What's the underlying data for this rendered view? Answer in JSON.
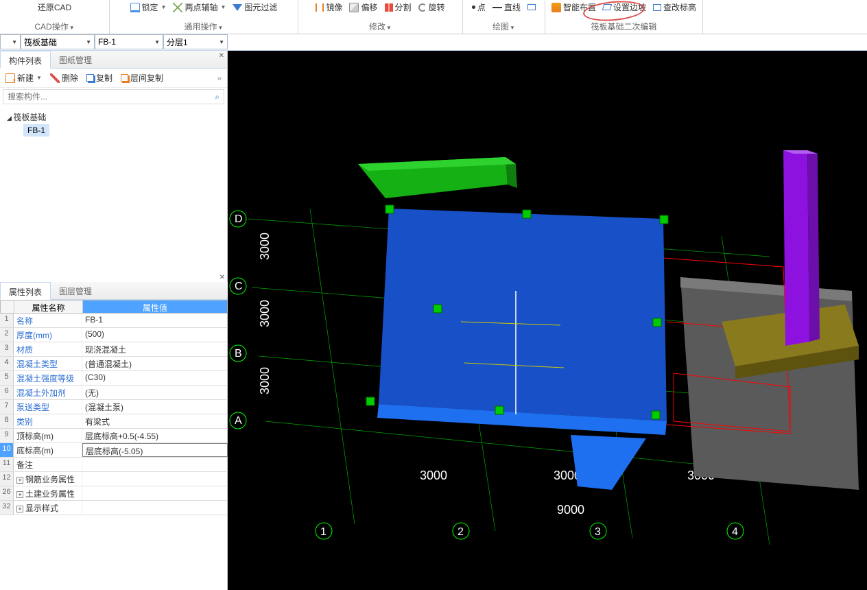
{
  "ribbon": {
    "cad_restore": "还原CAD",
    "cad_ops": "CAD操作",
    "lock": "锁定",
    "two_point_axis": "两点辅轴",
    "filter": "图元过滤",
    "general_ops": "通用操作",
    "mirror": "镜像",
    "offset": "偏移",
    "split": "分割",
    "rotate": "旋转",
    "modify": "修改",
    "point": "点",
    "line": "直线",
    "draw": "绘图",
    "smart": "智能布置",
    "set_slope": "设置边坡",
    "check_elev": "查改标高",
    "raft_edit": "筏板基础二次编辑"
  },
  "dropdowns": {
    "d1": "",
    "d2": "筏板基础",
    "d3": "FB-1",
    "d4": "分层1"
  },
  "component_panel": {
    "tab1": "构件列表",
    "tab2": "图纸管理",
    "new": "新建",
    "delete": "删除",
    "copy": "复制",
    "layer_copy": "层间复制",
    "search_placeholder": "搜索构件...",
    "tree_root": "筏板基础",
    "tree_item": "FB-1"
  },
  "property_panel": {
    "tab1": "属性列表",
    "tab2": "图层管理",
    "col_name": "属性名称",
    "col_val": "属性值",
    "rows": [
      {
        "n": "1",
        "name": "名称",
        "val": "FB-1",
        "link": true
      },
      {
        "n": "2",
        "name": "厚度(mm)",
        "val": "(500)",
        "link": true
      },
      {
        "n": "3",
        "name": "材质",
        "val": "现浇混凝土",
        "link": true
      },
      {
        "n": "4",
        "name": "混凝土类型",
        "val": "(普通混凝土)",
        "link": true
      },
      {
        "n": "5",
        "name": "混凝土强度等级",
        "val": "(C30)",
        "link": true
      },
      {
        "n": "6",
        "name": "混凝土外加剂",
        "val": "(无)",
        "link": true
      },
      {
        "n": "7",
        "name": "泵送类型",
        "val": "(混凝土泵)",
        "link": true
      },
      {
        "n": "8",
        "name": "类别",
        "val": "有梁式",
        "link": true
      },
      {
        "n": "9",
        "name": "顶标高(m)",
        "val": "层底标高+0.5(-4.55)",
        "link": false
      },
      {
        "n": "10",
        "name": "底标高(m)",
        "val": "层底标高(-5.05)",
        "link": false,
        "sel": true
      },
      {
        "n": "11",
        "name": "备注",
        "val": "",
        "link": false
      },
      {
        "n": "12",
        "name": "钢筋业务属性",
        "val": "",
        "link": false,
        "exp": true
      },
      {
        "n": "26",
        "name": "土建业务属性",
        "val": "",
        "link": false,
        "exp": true
      },
      {
        "n": "32",
        "name": "显示样式",
        "val": "",
        "link": false,
        "exp": true
      }
    ]
  },
  "viewport": {
    "axes_v": [
      "D",
      "C",
      "B",
      "A"
    ],
    "axes_h": [
      "1",
      "2",
      "3",
      "4"
    ],
    "dims_v": [
      "3000",
      "3000",
      "3000"
    ],
    "dims_h": [
      "3000",
      "3000",
      "3000"
    ],
    "dim_total": "9000"
  }
}
